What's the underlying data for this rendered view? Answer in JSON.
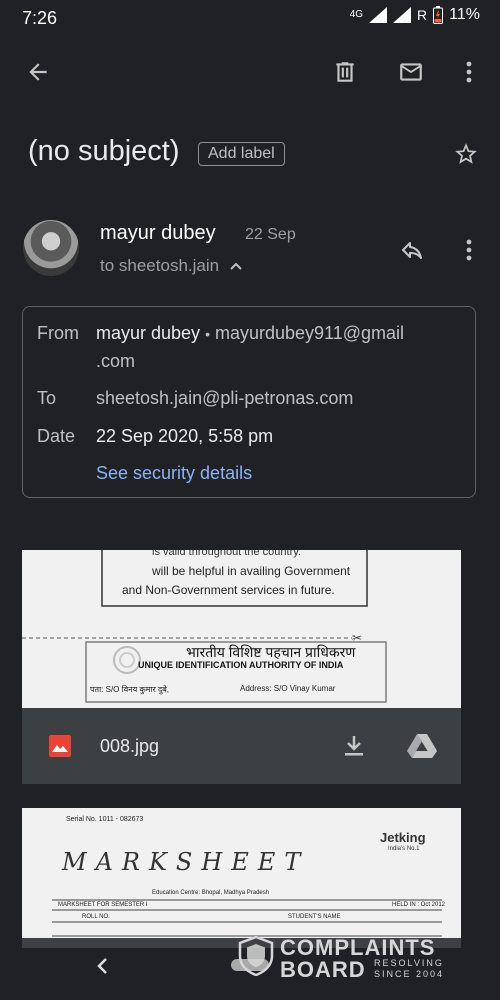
{
  "status": {
    "time": "7:26",
    "network": "4G",
    "roaming": "R",
    "battery": "11%"
  },
  "toolbar": {
    "back_icon": "arrow-left-icon",
    "delete_icon": "trash-icon",
    "mail_icon": "envelope-icon",
    "more_icon": "more-vert-icon"
  },
  "subject": {
    "text": "(no subject)",
    "add_label": "Add label"
  },
  "message": {
    "sender_name": "mayur dubey",
    "date_short": "22 Sep",
    "to_summary": "to sheetosh.jain",
    "details": {
      "from_label": "From",
      "from_name": "mayur dubey",
      "from_sep": "•",
      "from_email_line1": "mayurdubey911@gmail",
      "from_email_line2": ".com",
      "to_label": "To",
      "to_value": "sheetosh.jain@pli-petronas.com",
      "date_label": "Date",
      "date_value": "22 Sep 2020, 5:58 pm",
      "security_link": "See security details"
    }
  },
  "attachments": [
    {
      "filename": "008.jpg",
      "thumb_lines": [
        "is valid throughout the country.",
        "will be helpful in availing Government",
        "and Non-Government services in future.",
        "भारतीय विशिष्ट पहचान प्राधिकरण",
        "UNIQUE IDENTIFICATION AUTHORITY OF INDIA",
        "पता: S/O विनय कुमार दुबे,",
        "Address: S/O Vinay Kumar"
      ]
    },
    {
      "thumb_lines": [
        "Serial No. 1011 - 082673",
        "MARKSHEET",
        "Jetking",
        "India's No.1",
        "Education Centre: Bhopal, Madhya Pradesh",
        "MARKSHEET FOR SEMESTER I",
        "HELD IN : Oct 2012",
        "ROLL NO.",
        "STUDENT'S NAME"
      ]
    }
  ],
  "watermark": {
    "line1": "COMPLAINTS",
    "line2": "BOARD",
    "line3": "RESOLVING",
    "line4": "SINCE 2004"
  },
  "navigation": {
    "back_icon": "nav-back-icon"
  }
}
